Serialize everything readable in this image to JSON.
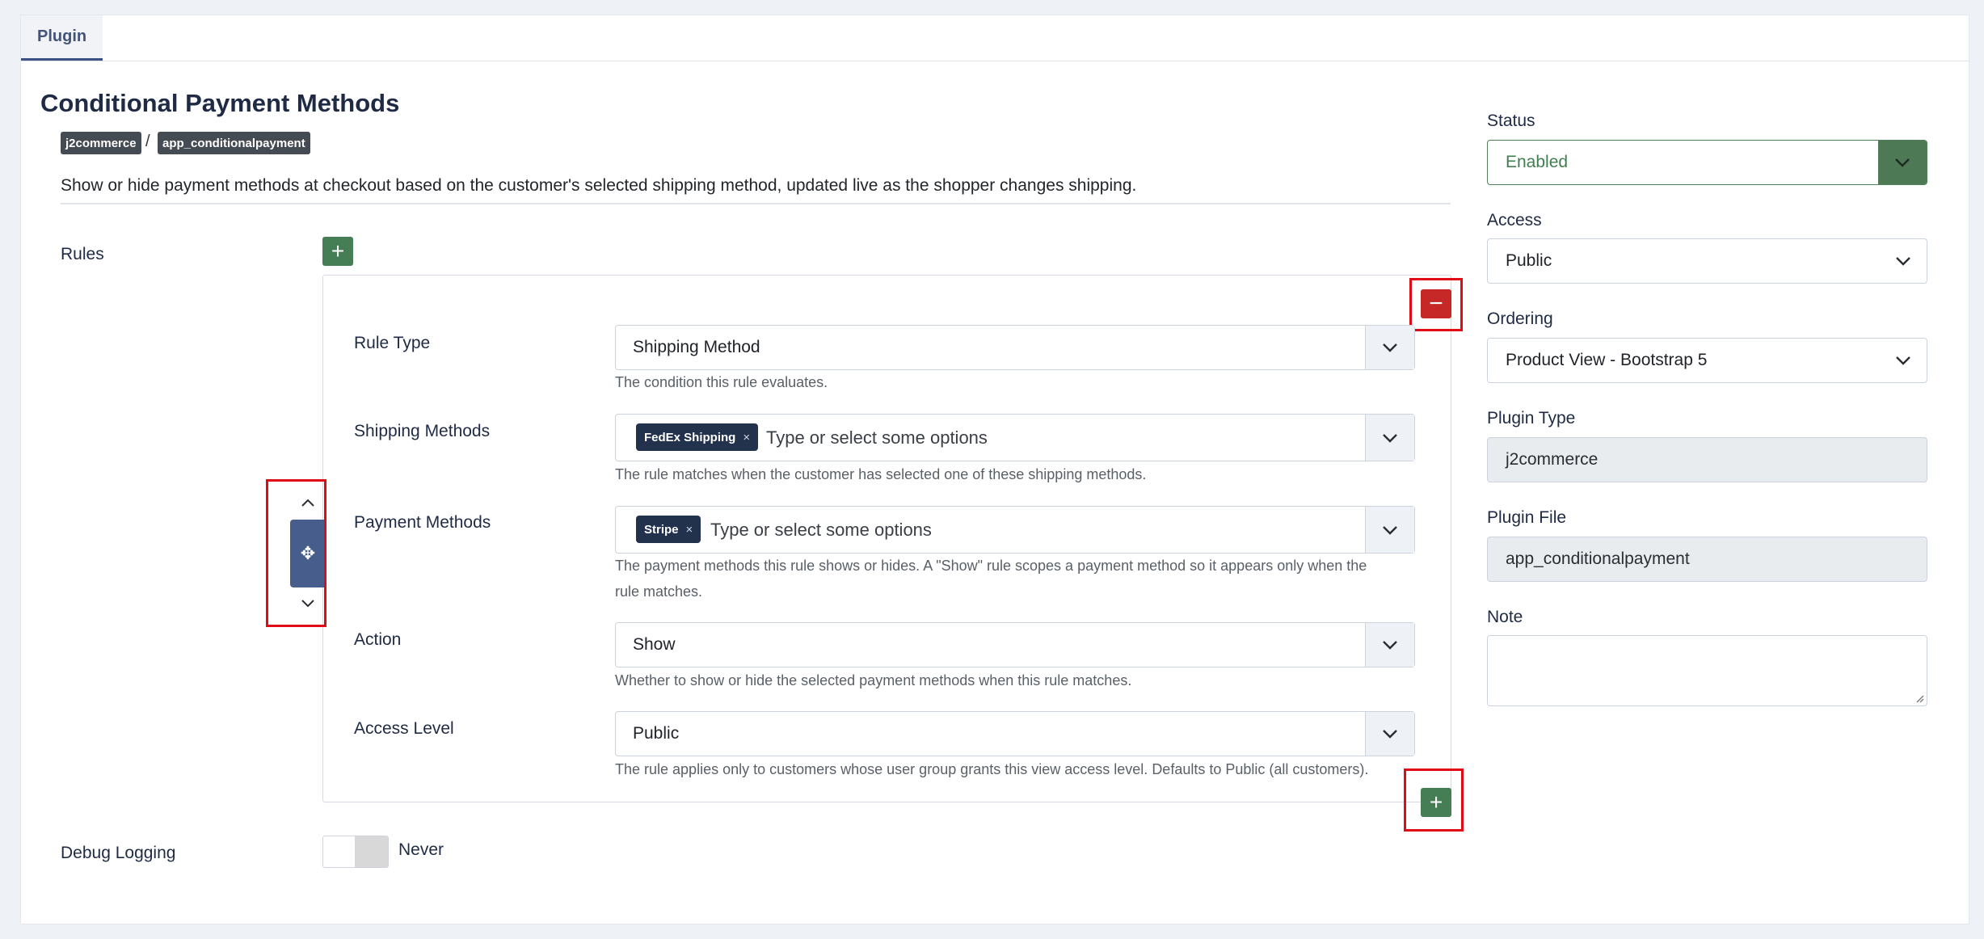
{
  "tabs": [
    {
      "label": "Plugin",
      "active": true
    }
  ],
  "header": {
    "title": "Conditional Payment Methods",
    "badges": [
      "j2commerce",
      "app_conditionalpayment"
    ],
    "separator": "/",
    "description": "Show or hide payment methods at checkout based on the customer's selected shipping method, updated live as the shopper changes shipping."
  },
  "rules": {
    "label": "Rules",
    "add_button_symbol": "+",
    "remove_button_symbol": "−",
    "move_handle_symbol": "✥",
    "items": [
      {
        "rule_type": {
          "label": "Rule Type",
          "value": "Shipping Method",
          "help": "The condition this rule evaluates."
        },
        "shipping_methods": {
          "label": "Shipping Methods",
          "selected": [
            "FedEx Shipping"
          ],
          "placeholder": "Type or select some options",
          "help": "The rule matches when the customer has selected one of these shipping methods."
        },
        "payment_methods": {
          "label": "Payment Methods",
          "selected": [
            "Stripe"
          ],
          "placeholder": "Type or select some options",
          "help_line1": "The payment methods this rule shows or hides. A \"Show\" rule scopes a payment method so it appears only when the",
          "help_line2": "rule matches."
        },
        "action": {
          "label": "Action",
          "value": "Show",
          "help": "Whether to show or hide the selected payment methods when this rule matches."
        },
        "access_level": {
          "label": "Access Level",
          "value": "Public",
          "help": "The rule applies only to customers whose user group grants this view access level. Defaults to Public (all customers)."
        }
      }
    ]
  },
  "debug_logging": {
    "label": "Debug Logging",
    "value": "Never",
    "enabled": false
  },
  "chip_remove_symbol": "×",
  "sidebar": {
    "status": {
      "label": "Status",
      "value": "Enabled"
    },
    "access": {
      "label": "Access",
      "value": "Public"
    },
    "ordering": {
      "label": "Ordering",
      "value": "Product View - Bootstrap 5"
    },
    "plugin_type": {
      "label": "Plugin Type",
      "value": "j2commerce"
    },
    "plugin_file": {
      "label": "Plugin File",
      "value": "app_conditionalpayment"
    },
    "note": {
      "label": "Note",
      "value": ""
    }
  },
  "colors": {
    "accent": "#3d5185",
    "success": "#457d54",
    "danger": "#c52827",
    "highlight": "#e10b17"
  },
  "icons": [
    "plus-icon",
    "minus-icon",
    "move-icon",
    "chevron-up-icon",
    "chevron-down-icon",
    "close-icon"
  ]
}
